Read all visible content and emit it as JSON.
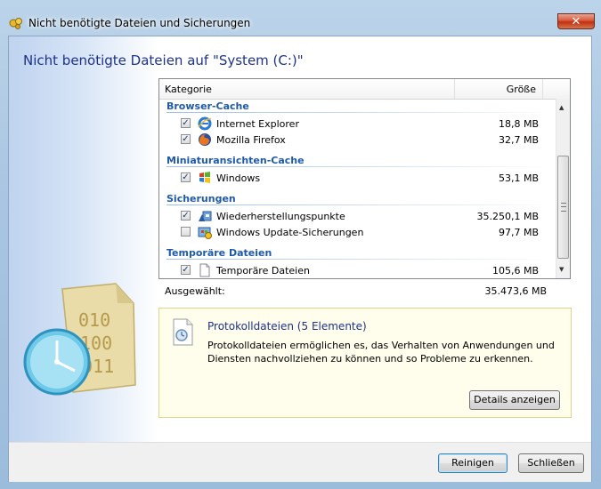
{
  "window": {
    "title": "Nicht benötigte Dateien und Sicherungen",
    "close_glyph": "✕"
  },
  "heading": "Nicht benötigte Dateien auf \"System (C:)\"",
  "list": {
    "columns": {
      "category": "Kategorie",
      "size": "Größe"
    },
    "groups": [
      {
        "name": "Browser-Cache",
        "items": [
          {
            "label": "Internet Explorer",
            "size": "18,8 MB",
            "checked": true,
            "icon": "internet-explorer-icon"
          },
          {
            "label": "Mozilla Firefox",
            "size": "32,7 MB",
            "checked": true,
            "icon": "firefox-icon"
          }
        ]
      },
      {
        "name": "Miniaturansichten-Cache",
        "items": [
          {
            "label": "Windows",
            "size": "53,1 MB",
            "checked": true,
            "icon": "windows-logo-icon"
          }
        ]
      },
      {
        "name": "Sicherungen",
        "items": [
          {
            "label": "Wiederherstellungspunkte",
            "size": "35.250,1 MB",
            "checked": true,
            "icon": "system-restore-icon"
          },
          {
            "label": "Windows Update-Sicherungen",
            "size": "97,7 MB",
            "checked": false,
            "icon": "windows-update-icon"
          }
        ]
      },
      {
        "name": "Temporäre Dateien",
        "items": [
          {
            "label": "Temporäre Dateien",
            "size": "105,6 MB",
            "checked": true,
            "icon": "file-icon"
          }
        ]
      }
    ],
    "scroll_up": "▲",
    "scroll_down": "▼"
  },
  "summary": {
    "selected_label": "Ausgewählt:",
    "selected_value": "35.473,6 MB"
  },
  "info": {
    "title": "Protokolldateien (5 Elemente)",
    "description": "Protokolldateien ermöglichen es, das Verhalten von Anwendungen und Diensten nachvollziehen zu können und so Probleme zu erkennen.",
    "details_button": "Details anzeigen"
  },
  "footer": {
    "clean_button": "Reinigen",
    "close_button": "Schließen"
  },
  "checkmark": "✓",
  "colors": {
    "heading": "#1e3287",
    "group": "#1e5aa8",
    "info_bg": "#fffdeb"
  }
}
